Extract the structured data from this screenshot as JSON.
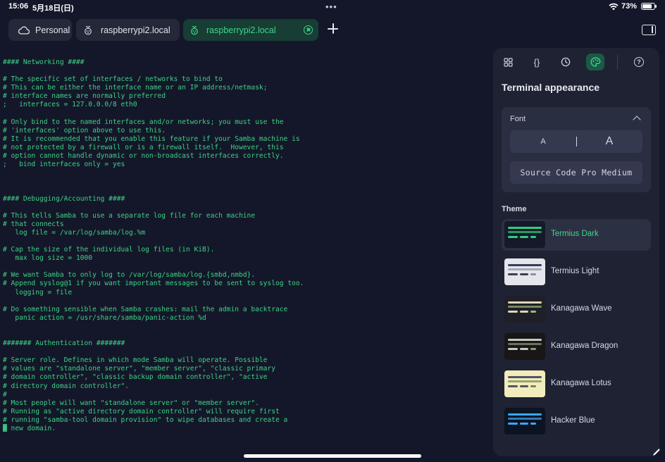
{
  "status": {
    "time": "15:06",
    "date": "5月18日(日)",
    "dots": "•••",
    "battery": "73%"
  },
  "tabs": [
    {
      "label": "Personal",
      "icon": "cloud-icon"
    },
    {
      "label": "raspberrypi2.local",
      "icon": "raspberry-icon"
    },
    {
      "label": "raspberrypi2.local",
      "icon": "raspberry-icon",
      "active": true
    }
  ],
  "terminal": {
    "lines": [
      "#### Networking ####",
      "",
      "# The specific set of interfaces / networks to bind to",
      "# This can be either the interface name or an IP address/netmask;",
      "# interface names are normally preferred",
      ";   interfaces = 127.0.0.0/8 eth0",
      "",
      "# Only bind to the named interfaces and/or networks; you must use the",
      "# 'interfaces' option above to use this.",
      "# It is recommended that you enable this feature if your Samba machine is",
      "# not protected by a firewall or is a firewall itself.  However, this",
      "# option cannot handle dynamic or non-broadcast interfaces correctly.",
      ";   bind interfaces only = yes",
      "",
      "",
      "",
      "#### Debugging/Accounting ####",
      "",
      "# This tells Samba to use a separate log file for each machine",
      "# that connects",
      "   log file = /var/log/samba/log.%m",
      "",
      "# Cap the size of the individual log files (in KiB).",
      "   max log size = 1000",
      "",
      "# We want Samba to only log to /var/log/samba/log.{smbd,nmbd}.",
      "# Append syslog@1 if you want important messages to be sent to syslog too.",
      "   logging = file",
      "",
      "# Do something sensible when Samba crashes: mail the admin a backtrace",
      "   panic action = /usr/share/samba/panic-action %d",
      "",
      "",
      "####### Authentication #######",
      "",
      "# Server role. Defines in which mode Samba will operate. Possible",
      "# values are \"standalone server\", \"member server\", \"classic primary",
      "# domain controller\", \"classic backup domain controller\", \"active",
      "# directory domain controller\".",
      "#",
      "# Most people will want \"standalone server\" or \"member server\".",
      "# Running as \"active directory domain controller\" will require first",
      "# running \"samba-tool domain provision\" to wipe databases and create a",
      "# new domain."
    ]
  },
  "panel": {
    "tab_icons": [
      "grid-icon",
      "braces-icon",
      "history-icon",
      "palette-icon",
      "help-icon"
    ],
    "braces_glyph": "{}",
    "help_glyph": "?",
    "title": "Terminal appearance",
    "font_label": "Font",
    "size_small": "A",
    "size_large": "A",
    "font_name": "Source Code Pro Medium",
    "theme_label": "Theme",
    "themes": [
      {
        "name": "Termius Dark",
        "bg": "#15192a",
        "bars": [
          "#2fcf7f",
          "#2fcf7f",
          "#2fcf7f"
        ],
        "selected": true
      },
      {
        "name": "Termius Light",
        "bg": "#e4e6ec",
        "bars": [
          "#3b3f55",
          "#8a8fa5",
          "#3b3f55"
        ]
      },
      {
        "name": "Kanagawa Wave",
        "bg": "#1f1f28",
        "bars": [
          "#dcd7ba",
          "#98bb6c",
          "#dcd7ba"
        ]
      },
      {
        "name": "Kanagawa Dragon",
        "bg": "#181616",
        "bars": [
          "#c5c9c5",
          "#8a9a7b",
          "#c5c9c5"
        ]
      },
      {
        "name": "Kanagawa Lotus",
        "bg": "#f2ecbc",
        "bars": [
          "#545464",
          "#6f894e",
          "#545464"
        ]
      },
      {
        "name": "Hacker Blue",
        "bg": "#0b1420",
        "bars": [
          "#3aa7ff",
          "#3aa7ff",
          "#3aa7ff"
        ]
      }
    ]
  }
}
